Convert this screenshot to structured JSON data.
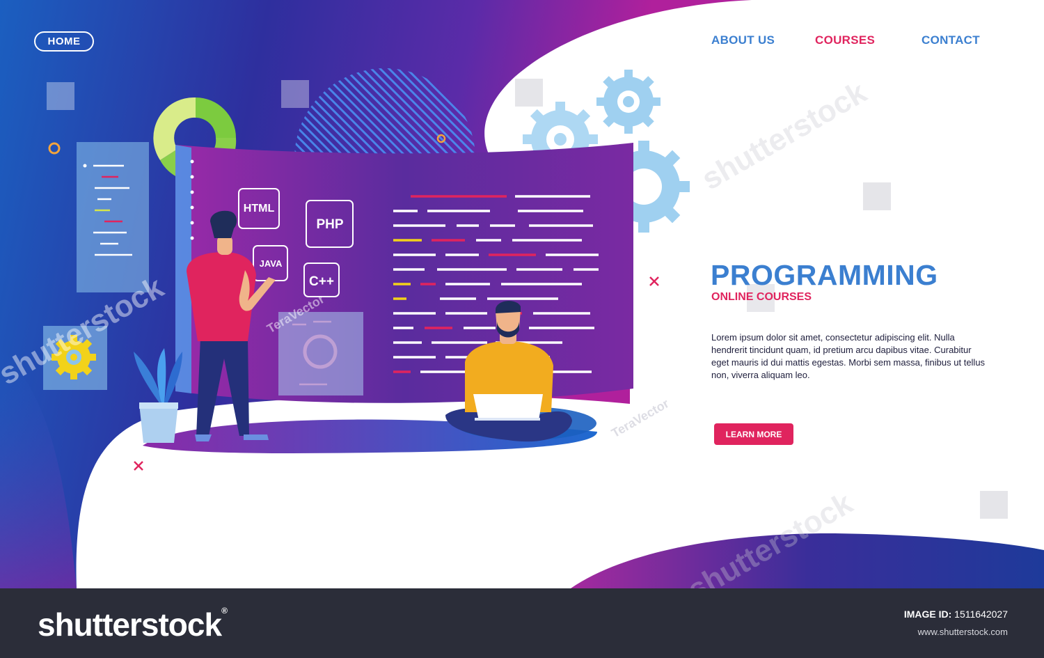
{
  "nav": {
    "home": "HOME",
    "about": "ABOUT US",
    "courses": "COURSES",
    "contact": "CONTACT"
  },
  "hero": {
    "title": "PROGRAMMING",
    "subtitle": "ONLINE COURSES",
    "body": "Lorem ipsum dolor sit amet, consectetur adipiscing elit. Nulla hendrerit tincidunt quam, id pretium arcu dapibus vitae. Curabitur eget mauris id dui mattis egestas. Morbi sem massa, finibus ut tellus non, viverra aliquam leo.",
    "button": "LEARN MORE"
  },
  "illustration": {
    "tags": [
      "HTML",
      "PHP",
      "JAVA",
      "C++"
    ]
  },
  "watermark": {
    "brand": "shutterstock",
    "author": "TeraVector"
  },
  "footer": {
    "logo": "shutterstock",
    "image_id_label": "IMAGE ID:",
    "image_id": "1511642027",
    "url": "www.shutterstock.com"
  },
  "colors": {
    "accent_blue": "#3b7fd0",
    "accent_pink": "#e0245e",
    "footer_bg": "#2b2d39"
  }
}
